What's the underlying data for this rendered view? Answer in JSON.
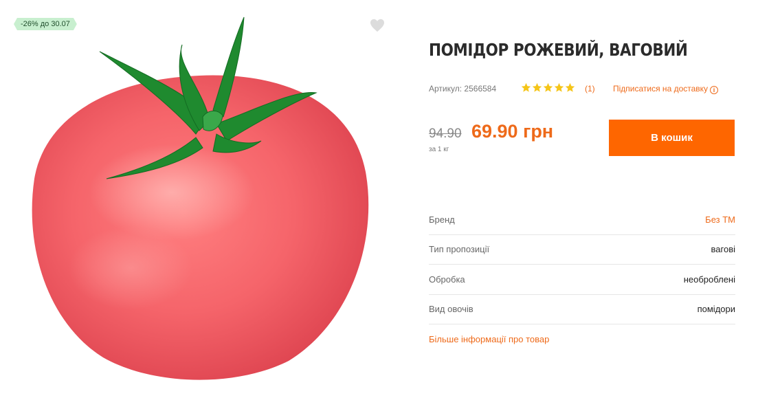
{
  "promo": {
    "badge": "-26% до 30.07"
  },
  "favorite": {
    "icon": "heart-icon"
  },
  "product": {
    "title": "ПОМІДОР РОЖЕВИЙ, ВАГОВИЙ",
    "sku_label": "Артикул:",
    "sku_value": "2566584",
    "rating": {
      "stars": 5,
      "count": "(1)"
    },
    "subscribe_label": "Підписатися на доставку",
    "image_icon": "pink-tomato-image"
  },
  "price": {
    "old": "94.90",
    "current": "69.90 грн",
    "unit": "за 1 кг"
  },
  "cart": {
    "label": "В кошик"
  },
  "specs": [
    {
      "label": "Бренд",
      "value": "Без ТМ"
    },
    {
      "label": "Тип пропозиції",
      "value": "вагові"
    },
    {
      "label": "Обробка",
      "value": "необроблені"
    },
    {
      "label": "Вид овочів",
      "value": "помідори"
    }
  ],
  "more_info": "Більше інформації про товар",
  "colors": {
    "accent": "#fe6600",
    "link": "#ee6a1a",
    "badge_bg": "#c8efcf",
    "star": "#f5c518"
  }
}
